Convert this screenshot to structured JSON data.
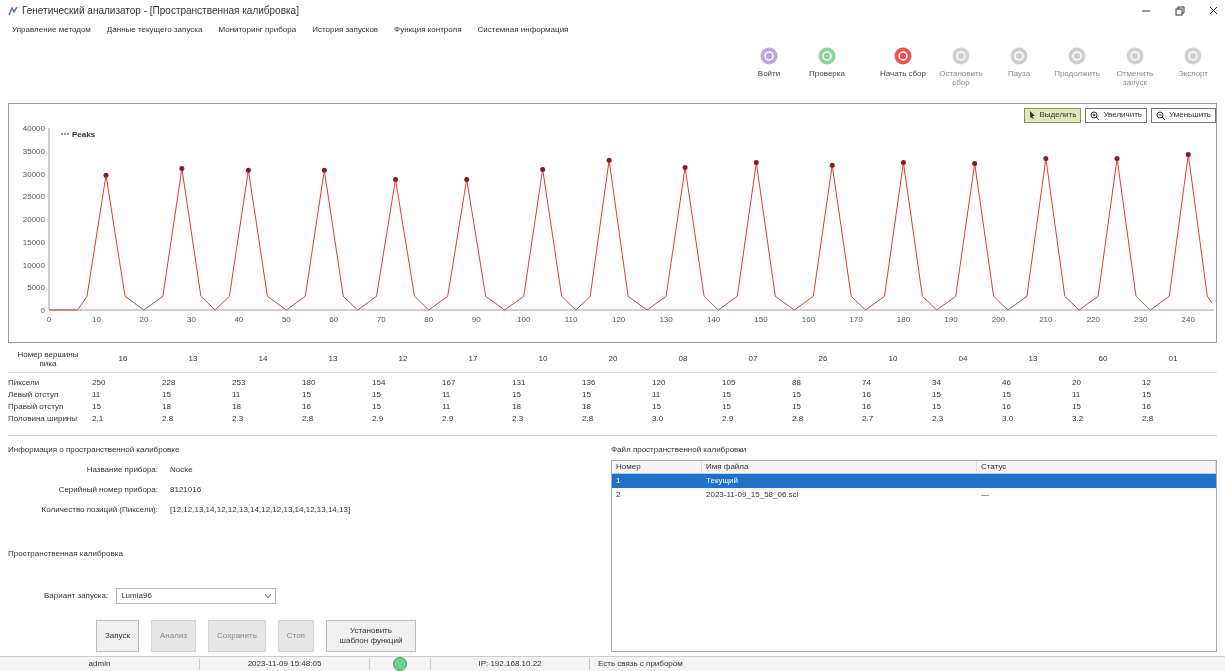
{
  "window": {
    "title": "Генетический анализатор - [Пространственная калибровка]"
  },
  "menu": [
    "Управление методом",
    "Данные текущего запуска",
    "Мониторинг прибора",
    "История запусков",
    "Функция контроля",
    "Системная информация"
  ],
  "toolbar": [
    {
      "label": "Войти",
      "color": "#b9a9e0",
      "disabled": false
    },
    {
      "label": "Проверка",
      "color": "#8fd3a4",
      "disabled": false
    },
    {
      "label": "Начать сбор",
      "color": "#ef5350",
      "disabled": false
    },
    {
      "label": "Остановить сбор",
      "color": "#d0d0d0",
      "disabled": true
    },
    {
      "label": "Пауза",
      "color": "#d0d0d0",
      "disabled": true
    },
    {
      "label": "Продолжить",
      "color": "#d0d0d0",
      "disabled": true
    },
    {
      "label": "Отменить запуск",
      "color": "#d0d0d0",
      "disabled": true
    },
    {
      "label": "Экспорт",
      "color": "#d0d0d0",
      "disabled": true
    }
  ],
  "chart_panel": {
    "tools": [
      {
        "label": "Выделить",
        "kind": "pointer",
        "selected": true
      },
      {
        "label": "Увеличить",
        "kind": "zoom-in",
        "selected": false
      },
      {
        "label": "Уменьшить",
        "kind": "zoom-out",
        "selected": false
      }
    ],
    "chart_data": {
      "type": "line",
      "xlim": [
        0,
        245
      ],
      "ylim": [
        0,
        40000
      ],
      "xticks": [
        0,
        10,
        20,
        30,
        40,
        50,
        60,
        70,
        80,
        90,
        100,
        110,
        120,
        130,
        140,
        150,
        160,
        170,
        180,
        190,
        200,
        210,
        220,
        230,
        240
      ],
      "yticks": [
        0,
        5000,
        10000,
        15000,
        20000,
        25000,
        30000,
        35000,
        40000
      ],
      "x": [
        0,
        6,
        8,
        12,
        16,
        20,
        24,
        28,
        32,
        35,
        38,
        42,
        46,
        50,
        54,
        58,
        62,
        65,
        69,
        73,
        77,
        80,
        84,
        88,
        92,
        96,
        100,
        104,
        108,
        111,
        114,
        118,
        122,
        126,
        130,
        134,
        138,
        141,
        145,
        149,
        153,
        157,
        161,
        165,
        169,
        172,
        176,
        180,
        184,
        187,
        191,
        195,
        199,
        202,
        206,
        210,
        214,
        217,
        221,
        225,
        229,
        232,
        236,
        240,
        244,
        245
      ],
      "series": [
        {
          "name": "Peaks",
          "color": "#e53935",
          "values": [
            0,
            0,
            3000,
            29600,
            3000,
            0,
            3000,
            31100,
            3000,
            0,
            3000,
            30700,
            3000,
            0,
            3000,
            30700,
            3000,
            0,
            3000,
            28700,
            3000,
            0,
            3000,
            28700,
            3000,
            0,
            3000,
            30900,
            3000,
            0,
            3000,
            32900,
            3000,
            0,
            3000,
            31300,
            3000,
            0,
            3000,
            32400,
            3000,
            0,
            3000,
            31800,
            3000,
            0,
            3000,
            32400,
            3000,
            0,
            3000,
            32200,
            3000,
            0,
            3000,
            33300,
            3000,
            0,
            3000,
            33300,
            3000,
            0,
            3000,
            34200,
            3000,
            1500
          ]
        }
      ]
    }
  },
  "peak_table": {
    "rows": [
      {
        "label": "Номер вершины пика",
        "cells": [
          "16",
          "13",
          "14",
          "13",
          "12",
          "17",
          "10",
          "20",
          "08",
          "07",
          "26",
          "10",
          "04",
          "13",
          "60",
          "01"
        ]
      },
      {
        "label": "Пиксели",
        "cells": [
          "250",
          "228",
          "253",
          "180",
          "154",
          "167",
          "131",
          "136",
          "120",
          "105",
          "88",
          "74",
          "34",
          "46",
          "20",
          "12"
        ]
      },
      {
        "label": "Левый отступ",
        "cells": [
          "11",
          "15",
          "11",
          "15",
          "15",
          "11",
          "15",
          "15",
          "11",
          "15",
          "15",
          "16",
          "15",
          "15",
          "11",
          "15"
        ]
      },
      {
        "label": "Правый отступ",
        "cells": [
          "15",
          "18",
          "18",
          "16",
          "15",
          "11",
          "18",
          "18",
          "15",
          "15",
          "15",
          "16",
          "15",
          "16",
          "15",
          "16"
        ]
      },
      {
        "label": "Половина ширины",
        "cells": [
          "2.1",
          "2.8",
          "2.3",
          "2.8",
          "2.9",
          "2.9",
          "2.3",
          "2.8",
          "3.0",
          "2.9",
          "2.8",
          "2.7",
          "2.3",
          "3.0",
          "3.2",
          "2.8"
        ]
      }
    ]
  },
  "calibration_info": {
    "title": "Информация о пространственной калибровке",
    "fields": [
      {
        "label": "Название прибора:",
        "value": "Nocke"
      },
      {
        "label": "Серийный номер прибора:",
        "value": "8121016"
      },
      {
        "label": "Количество позиций (Пиксели):",
        "value": "[12,12,13,14,12,12,13,14,12,12,13,14,12,13,14,13]"
      }
    ]
  },
  "calibration": {
    "title": "Пространственная калибровка",
    "run_option": {
      "label": "Вариант запуска:",
      "value": "Lumia96"
    },
    "buttons": [
      {
        "label": "Запуск",
        "disabled": false
      },
      {
        "label": "Анализ",
        "disabled": true
      },
      {
        "label": "Сохранить",
        "disabled": true
      },
      {
        "label": "Стоп",
        "disabled": true
      },
      {
        "label": "Установить шаблон функций",
        "disabled": false
      }
    ]
  },
  "file_panel": {
    "title": "Файл пространственной калибровки",
    "columns": [
      "Номер",
      "Имя файла",
      "Статус"
    ],
    "rows": [
      {
        "cells": [
          "1",
          "Текущий",
          ""
        ],
        "selected": true
      },
      {
        "cells": [
          "2",
          "2023-11-09_15_58_06.scl",
          "—"
        ],
        "selected": false
      }
    ]
  },
  "status_bar": {
    "user": "admin",
    "time": "2023-11-09 15:48:05",
    "connected": true,
    "ip": "IP: 192.168.10.22",
    "message": "Есть связь с прибором"
  }
}
